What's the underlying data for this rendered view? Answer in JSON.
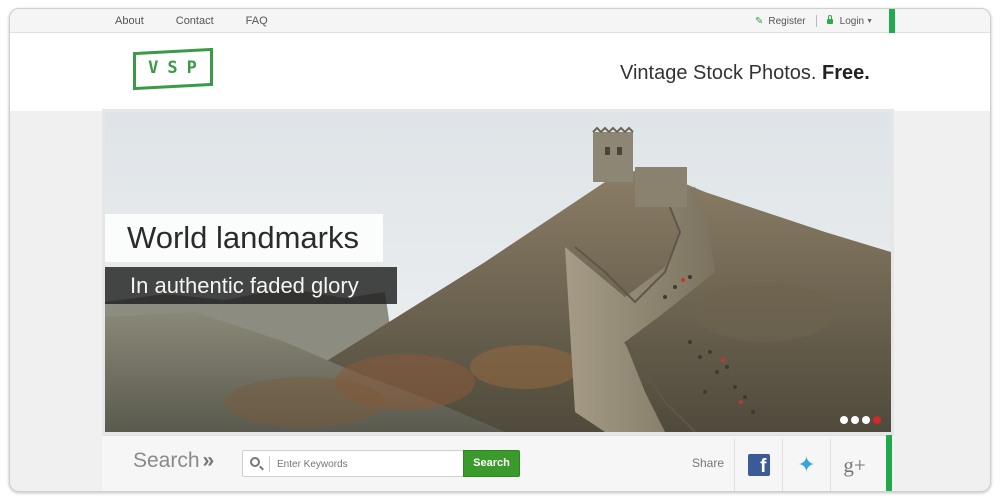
{
  "nav": {
    "links": [
      "About",
      "Contact",
      "FAQ"
    ],
    "register_label": "Register",
    "login_label": "Login"
  },
  "brand": {
    "logo_text": "VSP",
    "tagline_prefix": "Vintage Stock Photos.",
    "tagline_bold": "Free."
  },
  "hero": {
    "title": "World landmarks",
    "subtitle": "In authentic faded glory",
    "slides_count": 4,
    "active_slide": 4
  },
  "search": {
    "label": "Search",
    "placeholder": "Enter Keywords",
    "button_label": "Search"
  },
  "share": {
    "label": "Share",
    "networks": [
      "facebook",
      "twitter",
      "google-plus"
    ]
  },
  "icons": [
    "pencil-icon",
    "lock-icon",
    "search-icon",
    "chevron-double-right-icon",
    "facebook-icon",
    "twitter-icon",
    "google-plus-icon"
  ],
  "colors": {
    "accent_green": "#1faa4b",
    "button_green": "#3a9a2c",
    "facebook_blue": "#3b5a98",
    "twitter_blue": "#3aa3dc",
    "active_dot": "#d12a2a"
  }
}
